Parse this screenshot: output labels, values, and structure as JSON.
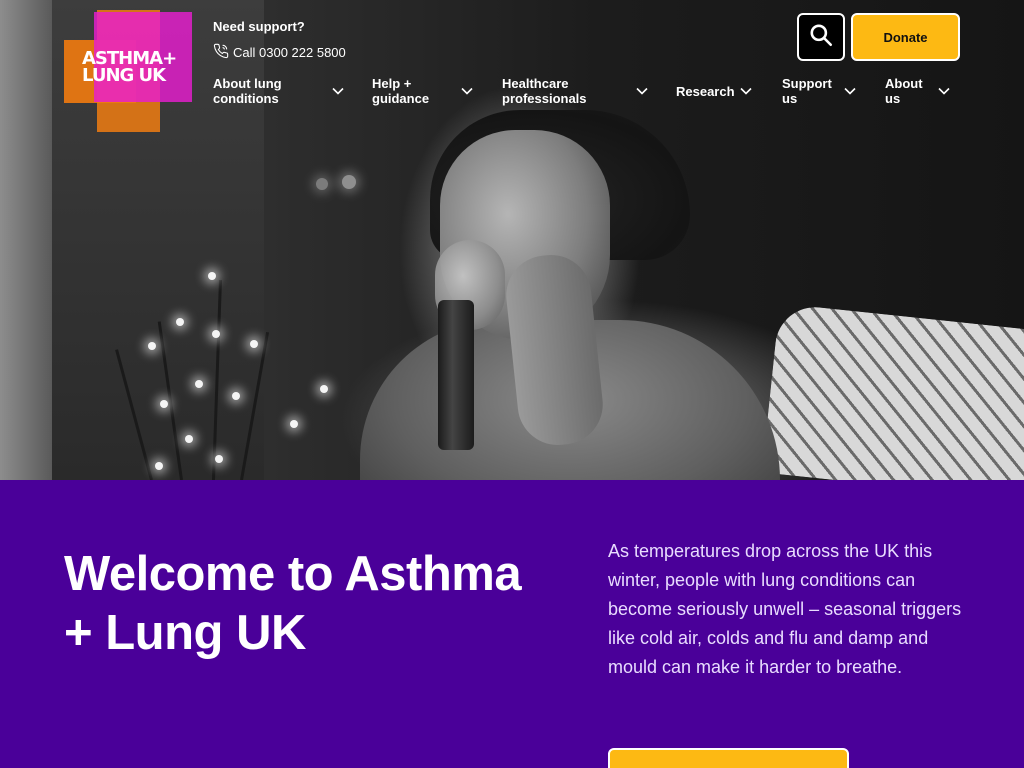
{
  "brand": {
    "logo_text_line1": "ASTHMA+",
    "logo_text_line2": "LUNG UK",
    "colors": {
      "purple": "#4a0099",
      "yellow": "#fdb913",
      "magenta": "#e81dd0",
      "orange": "#f07d12"
    }
  },
  "header": {
    "support_title": "Need support?",
    "support_phone": "Call 0300 222 5800",
    "phone_icon": "phone-icon",
    "search_icon": "search-icon",
    "donate_label": "Donate"
  },
  "nav": {
    "items": [
      {
        "line1": "About lung",
        "line2": "conditions"
      },
      {
        "line1": "Help +",
        "line2": "guidance"
      },
      {
        "line1": "Healthcare",
        "line2": "professionals"
      },
      {
        "line1": "Research",
        "line2": ""
      },
      {
        "line1": "Support",
        "line2": "us"
      },
      {
        "line1": "About",
        "line2": "us"
      }
    ],
    "chevron_icon": "chevron-down-icon"
  },
  "main": {
    "heading_line1": "Welcome to Asthma",
    "heading_line2": "+ Lung UK",
    "intro": "As temperatures drop across the UK this winter, people with lung conditions can become seriously unwell – seasonal triggers like cold air, colds and flu and damp and mould can make it harder to breathe."
  }
}
